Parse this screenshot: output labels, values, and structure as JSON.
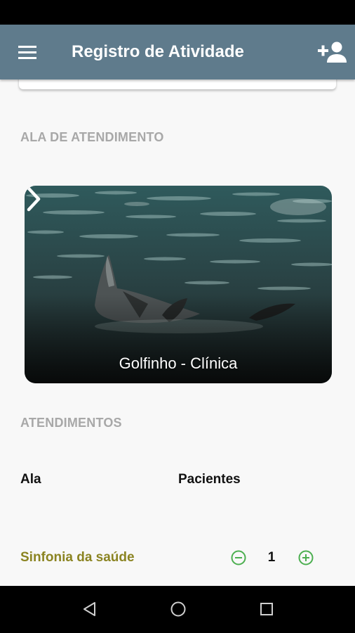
{
  "app_bar": {
    "title": "Registro de Atividade",
    "color": "#5f7b8c"
  },
  "icons": {
    "menu": "menu-icon",
    "add_person": "add-person-icon",
    "next": "chevron-right-icon",
    "decrement": "minus-circle-icon",
    "increment": "plus-circle-icon",
    "nav_back": "triangle-back-icon",
    "nav_home": "circle-home-icon",
    "nav_recents": "square-recents-icon"
  },
  "ward_section": {
    "header": "ALA DE ATENDIMENTO",
    "card": {
      "label": "Golfinho - Clínica"
    }
  },
  "attendance_section": {
    "header": "ATENDIMENTOS",
    "columns": [
      "Ala",
      "Pacientes"
    ],
    "rows": [
      {
        "name": "Sinfonia da saúde",
        "count": "1"
      }
    ]
  },
  "colors": {
    "row_name": "#8b8422",
    "stepper": "#4caf50",
    "section_header": "#a8a8a8"
  }
}
